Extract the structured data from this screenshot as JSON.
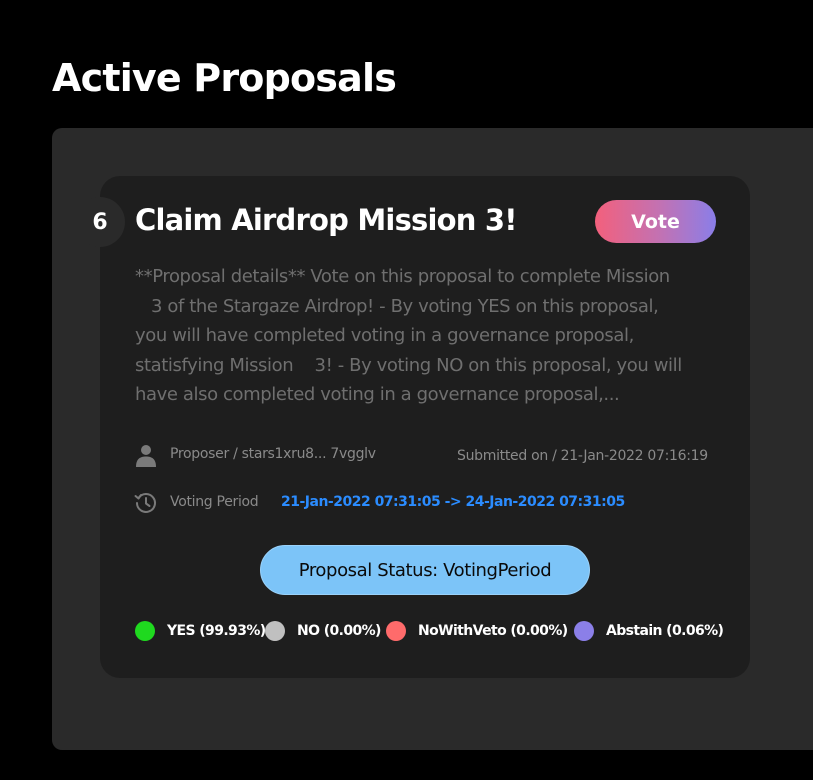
{
  "page": {
    "title": "Active Proposals"
  },
  "proposal": {
    "number": "6",
    "title": "Claim Airdrop Mission 3!",
    "vote_label": "Vote",
    "description": "**Proposal details** Vote on this proposal to complete Mission\n   3 of the Stargaze Airdrop! - By voting YES on this proposal,\nyou will have completed voting in a governance proposal,\nstatisfying Mission    3! - By voting NO on this proposal, you will\nhave also completed voting in a governance proposal,...",
    "proposer_label": "Proposer / stars1xru8... 7vgglv",
    "submitted_label": "Submitted on / 21-Jan-2022 07:16:19",
    "voting_period_label": "Voting Period",
    "voting_period_value": "21-Jan-2022 07:31:05 -> 24-Jan-2022 07:31:05",
    "status": "Proposal Status: VotingPeriod",
    "results": [
      {
        "label": "YES (99.93%)",
        "color": "#1fd91f"
      },
      {
        "label": "NO (0.00%)",
        "color": "#c0c0c0"
      },
      {
        "label": "NoWithVeto (0.00%)",
        "color": "#ff6b6b"
      },
      {
        "label": "Abstain (0.06%)",
        "color": "#8b7fe8"
      }
    ]
  },
  "icons": {
    "proposer": "user-icon",
    "voting_period": "history-clock-icon"
  },
  "colors": {
    "background": "#000000",
    "panel": "#2a2a2a",
    "card": "#1e1e1e",
    "accent_link": "#2b8cff",
    "status_pill": "#7cc4f8"
  }
}
